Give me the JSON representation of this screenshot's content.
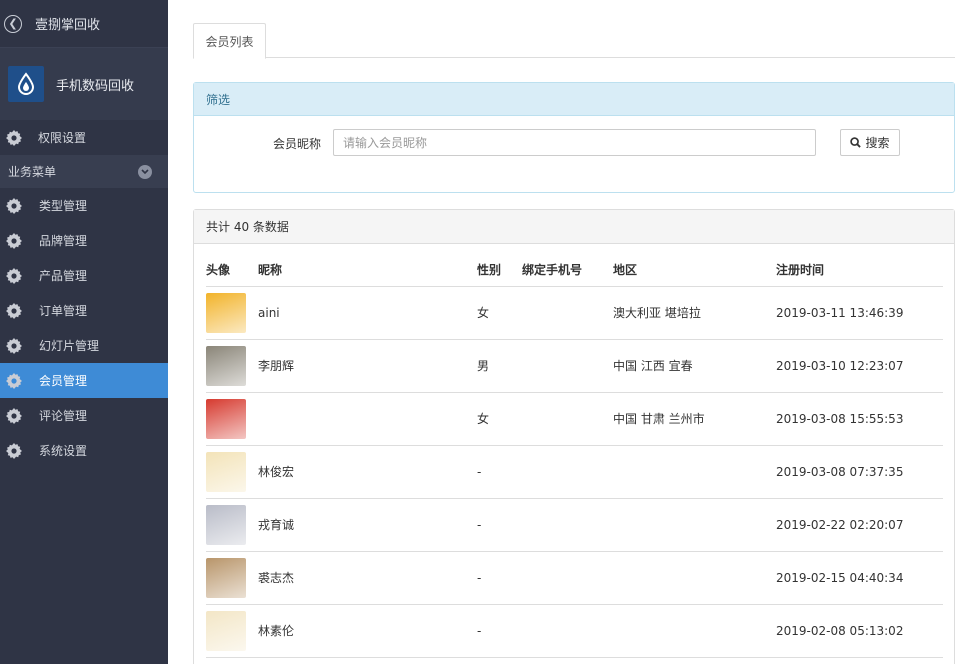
{
  "sidebar": {
    "top_title": "壹捌掌回收",
    "brand_name": "手机数码回收",
    "permission_label": "权限设置",
    "group_label": "业务菜单",
    "items": [
      {
        "label": "类型管理",
        "active": false
      },
      {
        "label": "品牌管理",
        "active": false
      },
      {
        "label": "产品管理",
        "active": false
      },
      {
        "label": "订单管理",
        "active": false
      },
      {
        "label": "幻灯片管理",
        "active": false
      },
      {
        "label": "会员管理",
        "active": true
      },
      {
        "label": "评论管理",
        "active": false
      },
      {
        "label": "系统设置",
        "active": false
      }
    ]
  },
  "tabs": {
    "active_label": "会员列表"
  },
  "filter": {
    "title": "筛选",
    "nickname_label": "会员昵称",
    "nickname_placeholder": "请输入会员昵称",
    "search_label": "搜索"
  },
  "list": {
    "summary": "共计 40 条数据",
    "columns": {
      "avatar": "头像",
      "nickname": "昵称",
      "gender": "性别",
      "phone": "绑定手机号",
      "region": "地区",
      "registered": "注册时间"
    },
    "rows": [
      {
        "nickname": "aini",
        "gender": "女",
        "phone": "",
        "region": "澳大利亚 堪培拉",
        "registered": "2019-03-11 13:46:39",
        "avatar_color": "#f2b32a"
      },
      {
        "nickname": "李朋辉",
        "gender": "男",
        "phone": "",
        "region": "中国 江西 宜春",
        "registered": "2019-03-10 12:23:07",
        "avatar_color": "#8a8578"
      },
      {
        "nickname": "",
        "gender": "女",
        "phone": "",
        "region": "中国 甘肃 兰州市",
        "registered": "2019-03-08 15:55:53",
        "avatar_color": "#d63a2f"
      },
      {
        "nickname": "林俊宏",
        "gender": "-",
        "phone": "",
        "region": "",
        "registered": "2019-03-08 07:37:35",
        "avatar_color": "#f3e3b8"
      },
      {
        "nickname": "戎育诚",
        "gender": "-",
        "phone": "",
        "region": "",
        "registered": "2019-02-22 02:20:07",
        "avatar_color": "#b9bcc8"
      },
      {
        "nickname": "裘志杰",
        "gender": "-",
        "phone": "",
        "region": "",
        "registered": "2019-02-15 04:40:34",
        "avatar_color": "#b8956a"
      },
      {
        "nickname": "林素伦",
        "gender": "-",
        "phone": "",
        "region": "",
        "registered": "2019-02-08 05:13:02",
        "avatar_color": "#f3e6c6"
      }
    ]
  },
  "colors": {
    "sidebar_bg": "#2f3445",
    "active_item": "#3e8bd6",
    "filter_head_bg": "#d9edf7",
    "filter_head_text": "#31708f"
  }
}
